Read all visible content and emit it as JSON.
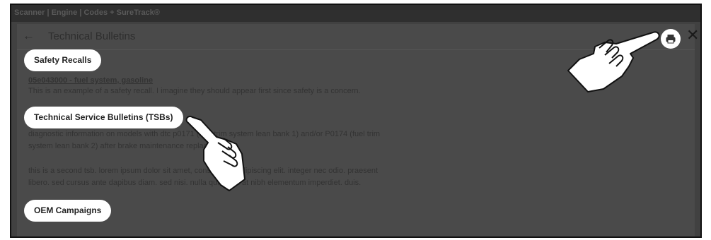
{
  "window": {
    "title": "Scanner | Engine | Codes + SureTrack®"
  },
  "header": {
    "back_icon": "←",
    "title": "Technical Bulletins",
    "close_icon": "✕"
  },
  "sections": {
    "safety_recalls": {
      "label": "Safety Recalls",
      "link": "05e043000 - fuel system, gasoline",
      "body": "This is an example of a safety recall. I imagine they should appear first since safety is a concern."
    },
    "tsbs": {
      "label": "Technical Service Bulletins (TSBs)",
      "para1_line1": "diagnostic information on models with dtc p0171 (fuel trim system lean bank 1) and/or P0174 (fuel trim",
      "para1_line2": "system lean bank 2) after brake maintenance replacement",
      "para2_line1": "this is a second tsb. lorem ipsum dolor sit amet, consectetur adipiscing elit. integer nec odio. praesent",
      "para2_line2": "libero. sed cursus ante dapibus diam. sed nisi. nulla quis sem at nibh elementum imperdiet. duis."
    },
    "oem_campaigns": {
      "label": "OEM Campaigns"
    }
  },
  "icons": {
    "print": "printer-icon",
    "pointer": "pointing-hand-icon"
  }
}
